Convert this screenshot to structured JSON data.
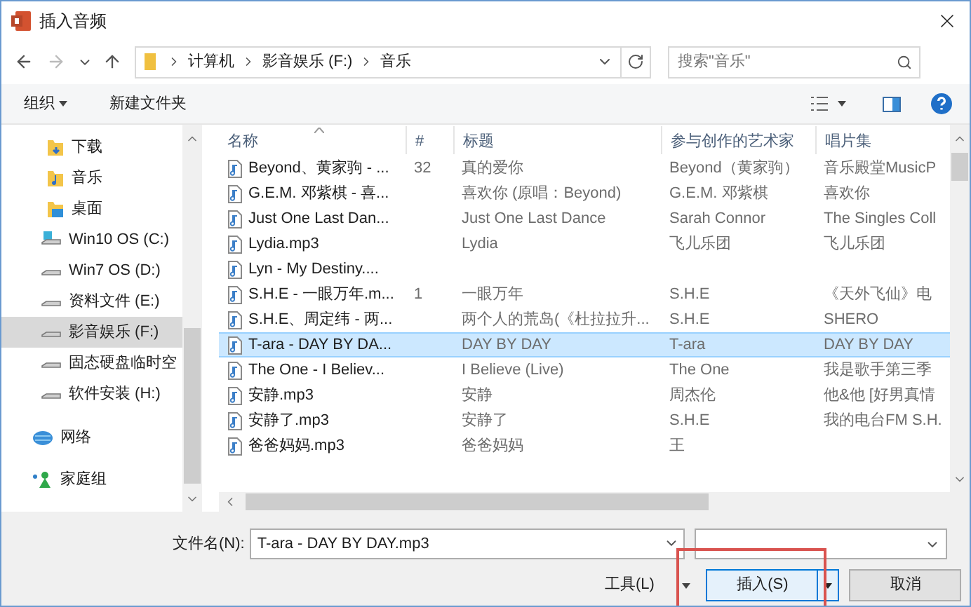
{
  "window": {
    "title": "插入音频"
  },
  "address_bar": {
    "path": [
      {
        "label": "计算机"
      },
      {
        "label": "影音娱乐 (F:)"
      },
      {
        "label": "音乐"
      }
    ]
  },
  "search": {
    "placeholder": "搜索\"音乐\""
  },
  "toolbar": {
    "organize": "组织",
    "new_folder": "新建文件夹"
  },
  "sidebar": {
    "items": [
      {
        "kind": "downloads",
        "label": "下载",
        "selected": false
      },
      {
        "kind": "music",
        "label": "音乐",
        "selected": false
      },
      {
        "kind": "desktop",
        "label": "桌面",
        "selected": false
      },
      {
        "kind": "system-drive",
        "label": "Win10 OS (C:)",
        "selected": false
      },
      {
        "kind": "drive",
        "label": "Win7 OS (D:)",
        "selected": false
      },
      {
        "kind": "drive",
        "label": "资料文件 (E:)",
        "selected": false
      },
      {
        "kind": "drive",
        "label": "影音娱乐 (F:)",
        "selected": true
      },
      {
        "kind": "drive",
        "label": "固态硬盘临时空",
        "selected": false
      },
      {
        "kind": "drive",
        "label": "软件安装 (H:)",
        "selected": false
      },
      {
        "kind": "network",
        "label": "网络",
        "selected": false
      },
      {
        "kind": "homegroup",
        "label": "家庭组",
        "selected": false
      }
    ]
  },
  "table": {
    "columns": [
      "名称",
      "#",
      "标题",
      "参与创作的艺术家",
      "唱片集"
    ],
    "rows": [
      {
        "name": "Beyond、黄家驹 - ...",
        "number": "32",
        "title": "真的爱你",
        "artist": "Beyond（黄家驹）",
        "album": "音乐殿堂MusicP",
        "selected": false
      },
      {
        "name": "G.E.M. 邓紫棋 - 喜...",
        "title": "喜欢你 (原唱：Beyond)",
        "artist": "G.E.M. 邓紫棋",
        "album": "喜欢你",
        "selected": false
      },
      {
        "name": "Just One Last Dan...",
        "title": "Just One Last Dance",
        "artist": "Sarah Connor",
        "album": "The Singles Coll",
        "selected": false
      },
      {
        "name": "Lydia.mp3",
        "title": "Lydia",
        "artist": "飞儿乐团",
        "album": "飞儿乐团",
        "selected": false
      },
      {
        "name": "Lyn - My Destiny....",
        "selected": false
      },
      {
        "name": "S.H.E - 一眼万年.m...",
        "number": "1",
        "title": "一眼万年",
        "artist": "S.H.E",
        "album": "《天外飞仙》电",
        "selected": false
      },
      {
        "name": "S.H.E、周定纬 - 两...",
        "title": "两个人的荒岛(《杜拉拉升...",
        "artist": "S.H.E",
        "album": "SHERO",
        "selected": false
      },
      {
        "name": "T-ara - DAY BY DA...",
        "title": "DAY BY DAY",
        "artist": "T-ara",
        "album": "DAY BY DAY",
        "selected": true
      },
      {
        "name": "The One - I Believ...",
        "title": "I Believe (Live)",
        "artist": "The One",
        "album": "我是歌手第三季",
        "selected": false
      },
      {
        "name": "安静.mp3",
        "title": "安静",
        "artist": "周杰伦",
        "album": "他&他 [好男真情",
        "selected": false
      },
      {
        "name": "安静了.mp3",
        "title": "安静了",
        "artist": "S.H.E",
        "album": "我的电台FM S.H.",
        "selected": false
      },
      {
        "name": "爸爸妈妈.mp3",
        "title": "爸爸妈妈",
        "artist": "王",
        "selected": false
      }
    ]
  },
  "footer": {
    "filename_label": "文件名(N):",
    "filename": "T-ara - DAY BY DAY.mp3",
    "tools": "工具(L)",
    "insert": "插入(S)",
    "cancel": "取消"
  }
}
